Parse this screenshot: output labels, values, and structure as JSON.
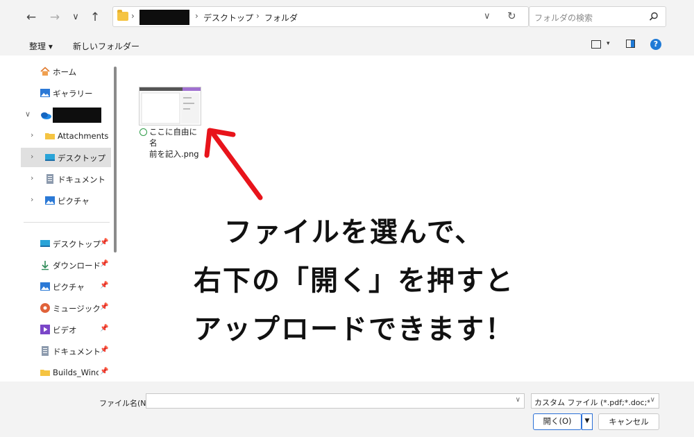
{
  "nav": {
    "back_icon": "←",
    "forward_icon": "→",
    "recent_icon": "∨",
    "up_icon": "↑"
  },
  "address": {
    "segments": [
      "デスクトップ",
      "フォルダ"
    ],
    "dropdown_icon": "∨",
    "refresh_icon": "↻"
  },
  "search": {
    "placeholder": "フォルダの検索",
    "icon": "⚲"
  },
  "toolbar": {
    "organize": "整理 ▾",
    "new_folder": "新しいフォルダー"
  },
  "sidebar": {
    "items": [
      {
        "label": "ホーム",
        "icon": "home-icon"
      },
      {
        "label": "ギャラリー",
        "icon": "gallery-icon"
      },
      {
        "label": "",
        "icon": "onedrive-icon"
      },
      {
        "label": "Attachments",
        "icon": "folder-icon"
      },
      {
        "label": "デスクトップ",
        "icon": "desktop-icon",
        "selected": true
      },
      {
        "label": "ドキュメント",
        "icon": "documents-icon"
      },
      {
        "label": "ピクチャ",
        "icon": "pictures-icon"
      }
    ],
    "pinned": [
      {
        "label": "デスクトップ",
        "icon": "desktop-icon"
      },
      {
        "label": "ダウンロード",
        "icon": "download-icon"
      },
      {
        "label": "ピクチャ",
        "icon": "pictures-icon"
      },
      {
        "label": "ミュージック",
        "icon": "music-icon"
      },
      {
        "label": "ビデオ",
        "icon": "video-icon"
      },
      {
        "label": "ドキュメント",
        "icon": "documents-icon"
      },
      {
        "label": "Builds_Windc",
        "icon": "folder-icon"
      }
    ]
  },
  "files": [
    {
      "name": "ここに自由に名前を記入.png",
      "name_line1": "ここに自由に名",
      "name_line2": "前を記入.png",
      "status": "synced"
    }
  ],
  "annotation": {
    "line1": "ファイルを選んで、",
    "line2": "右下の「開く」を押すと",
    "line3": "アップロードできます！"
  },
  "bottom": {
    "filename_label": "ファイル名(N):",
    "filename_value": "",
    "filetype_value": "カスタム ファイル (*.pdf;*.doc;*.doc",
    "open_label": "開く(O)",
    "cancel_label": "キャンセル"
  },
  "colors": {
    "accent": "#2a6fd6",
    "arrow": "#e8141b",
    "folder": "#f5c442"
  }
}
